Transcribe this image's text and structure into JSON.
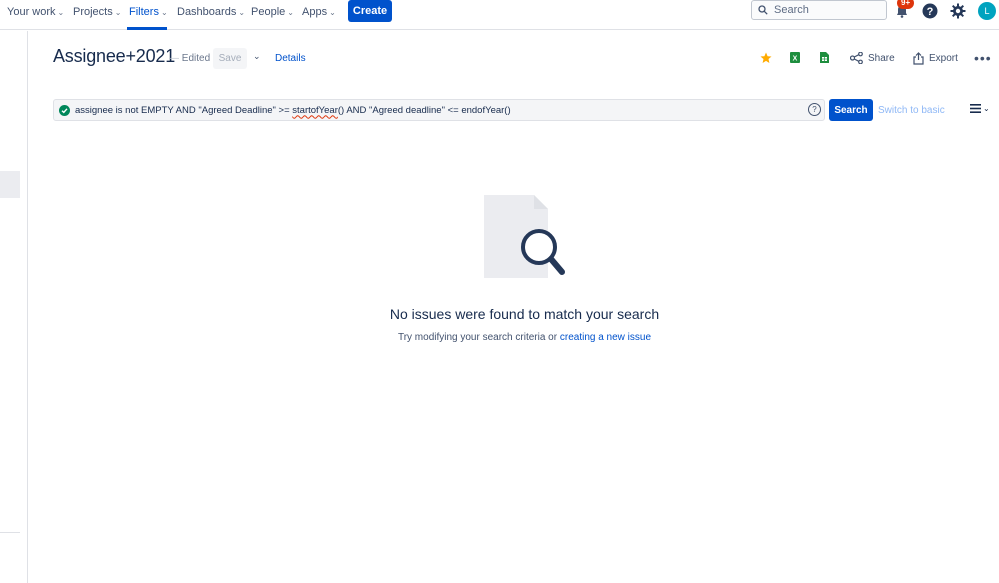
{
  "nav": {
    "items": [
      {
        "label": "Your work"
      },
      {
        "label": "Projects"
      },
      {
        "label": "Filters"
      },
      {
        "label": "Dashboards"
      },
      {
        "label": "People"
      },
      {
        "label": "Apps"
      }
    ],
    "create_label": "Create",
    "search_placeholder": "Search",
    "notification_badge": "9+",
    "avatar_initial": "L"
  },
  "filter": {
    "title": "Assignee+2021",
    "edited_label": "Edited",
    "save_label": "Save",
    "details_label": "Details",
    "share_label": "Share",
    "export_label": "Export"
  },
  "jql": {
    "query_part1": "assignee is not EMPTY AND \"Agreed Deadline\" >= ",
    "query_misspelled": "startofYear",
    "query_part2": "() AND \"Agreed deadline\" <= endofYear()",
    "help_symbol": "?",
    "search_label": "Search",
    "switch_label": "Switch to basic"
  },
  "empty_state": {
    "title": "No issues were found to match your search",
    "subtitle_prefix": "Try modifying your search criteria or ",
    "subtitle_link": "creating a new issue"
  },
  "colors": {
    "brand": "#0052cc",
    "star": "#ffab00",
    "excel": "#1e8e3e",
    "sheets": "#1e8e3e",
    "valid": "#00875a",
    "badge": "#de350b"
  }
}
